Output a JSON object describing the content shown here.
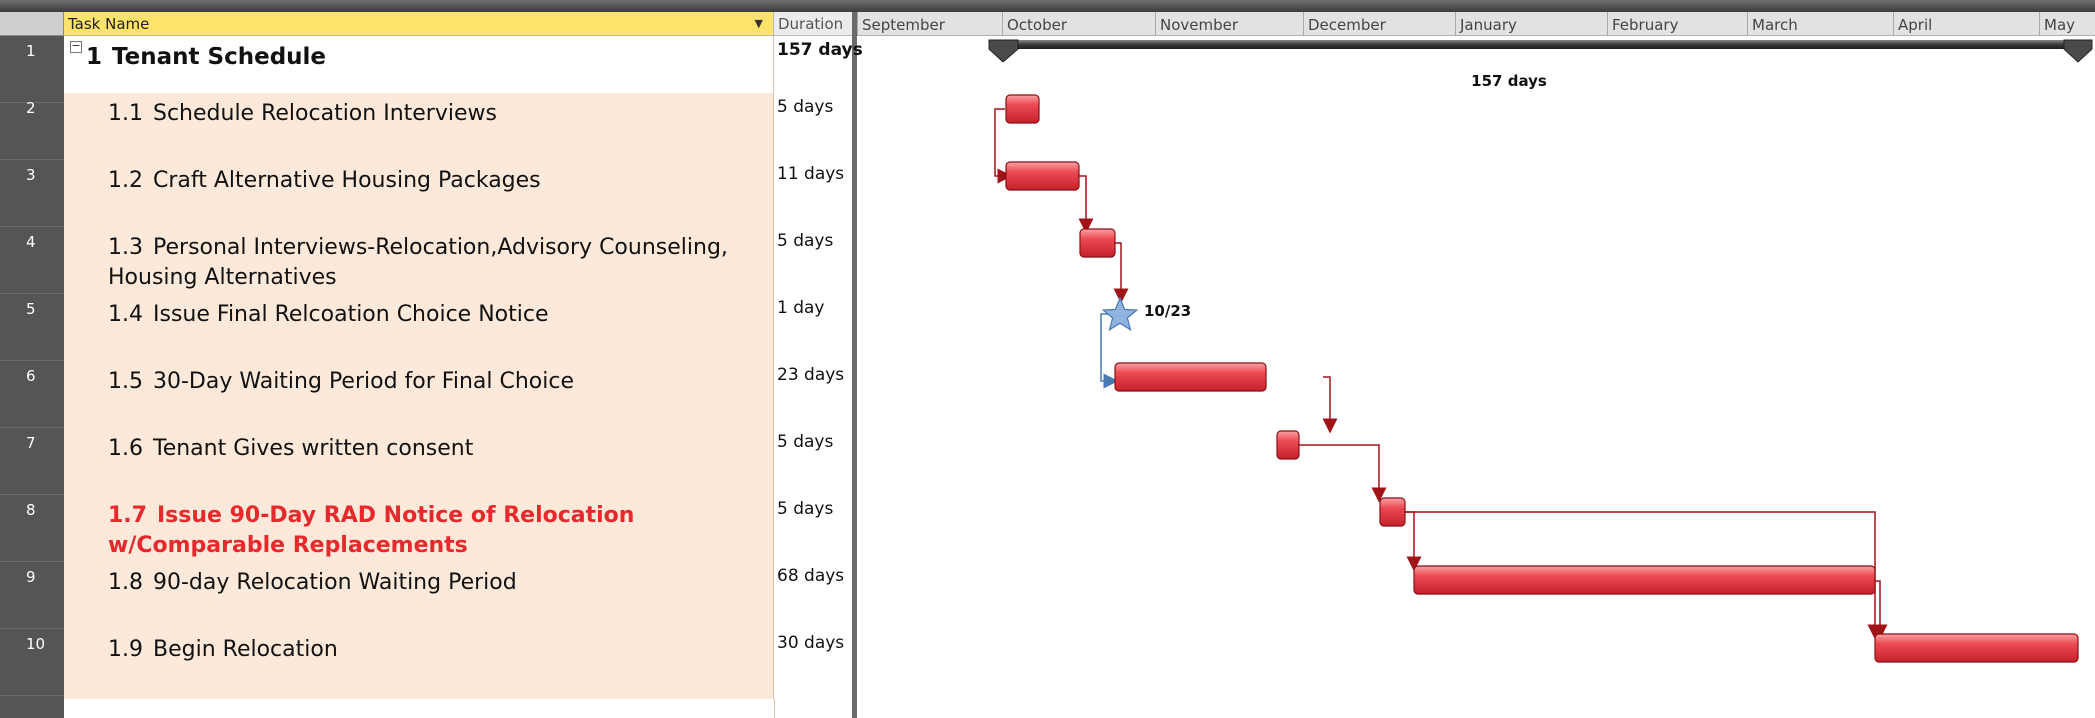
{
  "columns": {
    "task_name": "Task Name",
    "duration": "Duration"
  },
  "timescale": {
    "months": [
      "September",
      "October",
      "November",
      "December",
      "January",
      "February",
      "March",
      "April",
      "May"
    ]
  },
  "tasks": [
    {
      "row": "1",
      "id": "1",
      "name": "Tenant Schedule",
      "duration": "157 days",
      "summary": true,
      "critical": false
    },
    {
      "row": "2",
      "id": "1.1",
      "name": "Schedule Relocation Interviews",
      "duration": "5 days",
      "summary": false,
      "critical": false
    },
    {
      "row": "3",
      "id": "1.2",
      "name": "Craft Alternative Housing Packages",
      "duration": "11 days",
      "summary": false,
      "critical": false
    },
    {
      "row": "4",
      "id": "1.3",
      "name": "Personal Interviews-Relocation,Advisory Counseling, Housing Alternatives",
      "duration": "5 days",
      "summary": false,
      "critical": false
    },
    {
      "row": "5",
      "id": "1.4",
      "name": "Issue Final Relcoation Choice Notice",
      "duration": "1 day",
      "summary": false,
      "critical": false
    },
    {
      "row": "6",
      "id": "1.5",
      "name": "30-Day Waiting Period for Final Choice",
      "duration": "23 days",
      "summary": false,
      "critical": false
    },
    {
      "row": "7",
      "id": "1.6",
      "name": "Tenant Gives written consent",
      "duration": "5 days",
      "summary": false,
      "critical": false
    },
    {
      "row": "8",
      "id": "1.7",
      "name": "Issue 90-Day RAD Notice of Relocation w/Comparable Replacements",
      "duration": "5 days",
      "summary": false,
      "critical": true
    },
    {
      "row": "9",
      "id": "1.8",
      "name": "90-day Relocation Waiting Period",
      "duration": "68 days",
      "summary": false,
      "critical": false
    },
    {
      "row": "10",
      "id": "1.9",
      "name": "Begin Relocation",
      "duration": "30 days",
      "summary": false,
      "critical": false
    }
  ],
  "gantt": {
    "summary_bar_label": "157 days",
    "milestone_label": "10/23",
    "colors": {
      "task_bar": "#e8474f",
      "task_bar_border": "#8b0f14",
      "link_line": "#a01418",
      "summary_bar": "#3a3a3a",
      "milestone": "#8fb3df",
      "milestone_link": "#4a78b0"
    }
  }
}
